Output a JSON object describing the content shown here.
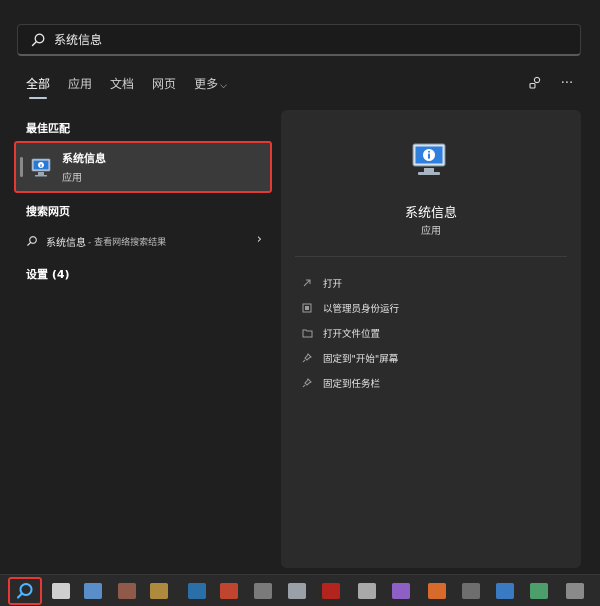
{
  "search": {
    "query": "系统信息"
  },
  "tabs": [
    {
      "label": "全部",
      "active": true
    },
    {
      "label": "应用"
    },
    {
      "label": "文档"
    },
    {
      "label": "网页"
    },
    {
      "label": "更多",
      "chevron": "⌵"
    }
  ],
  "left": {
    "best_match_title": "最佳匹配",
    "best_match": {
      "name": "系统信息",
      "type": "应用"
    },
    "web_title": "搜索网页",
    "web_result": {
      "query": "系统信息",
      "suffix": "- 查看网络搜索结果",
      "arrow": "›"
    },
    "settings_title": "设置 (4)"
  },
  "detail": {
    "title": "系统信息",
    "subtitle": "应用",
    "actions": [
      {
        "label": "打开",
        "icon": "open-icon"
      },
      {
        "label": "以管理员身份运行",
        "icon": "admin-icon"
      },
      {
        "label": "打开文件位置",
        "icon": "folder-icon"
      },
      {
        "label": "固定到\"开始\"屏幕",
        "icon": "pin-icon"
      },
      {
        "label": "固定到任务栏",
        "icon": "pin-icon"
      }
    ]
  },
  "top_icons": {
    "more": "···"
  },
  "colors": {
    "accent_red": "#e53935",
    "panel": "#2b2b2b",
    "background": "#1f1f1f"
  }
}
